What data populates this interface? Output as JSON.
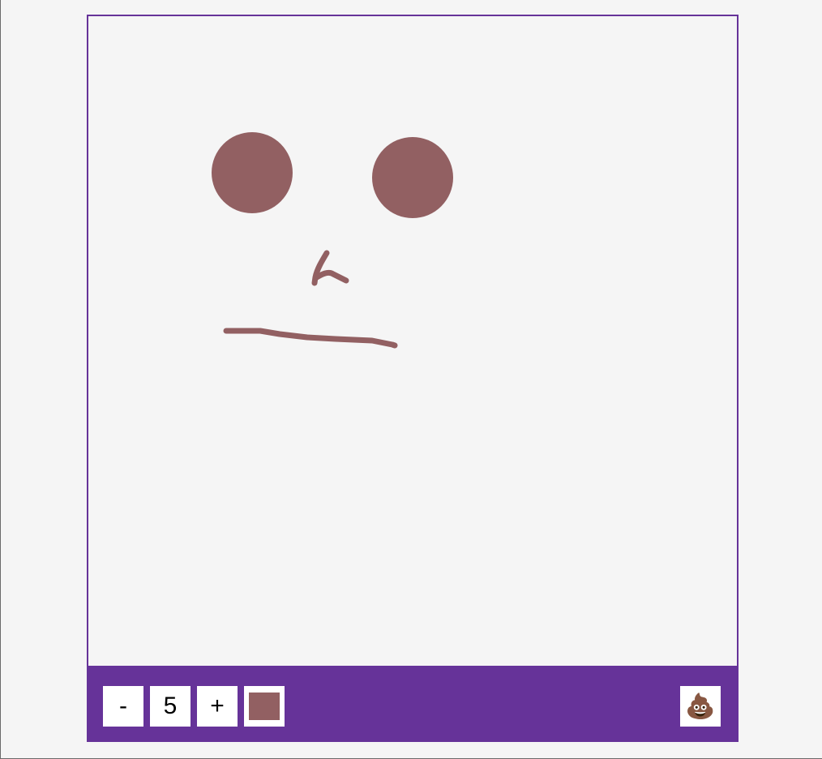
{
  "toolbar": {
    "decrease_label": "-",
    "brush_size": "5",
    "increase_label": "+",
    "brush_color": "#926062",
    "clear_icon": "pile-of-poo-icon",
    "clear_glyph": "💩"
  },
  "colors": {
    "accent": "#663399",
    "canvas_background": "#f5f5f5",
    "stroke": "#926062"
  }
}
